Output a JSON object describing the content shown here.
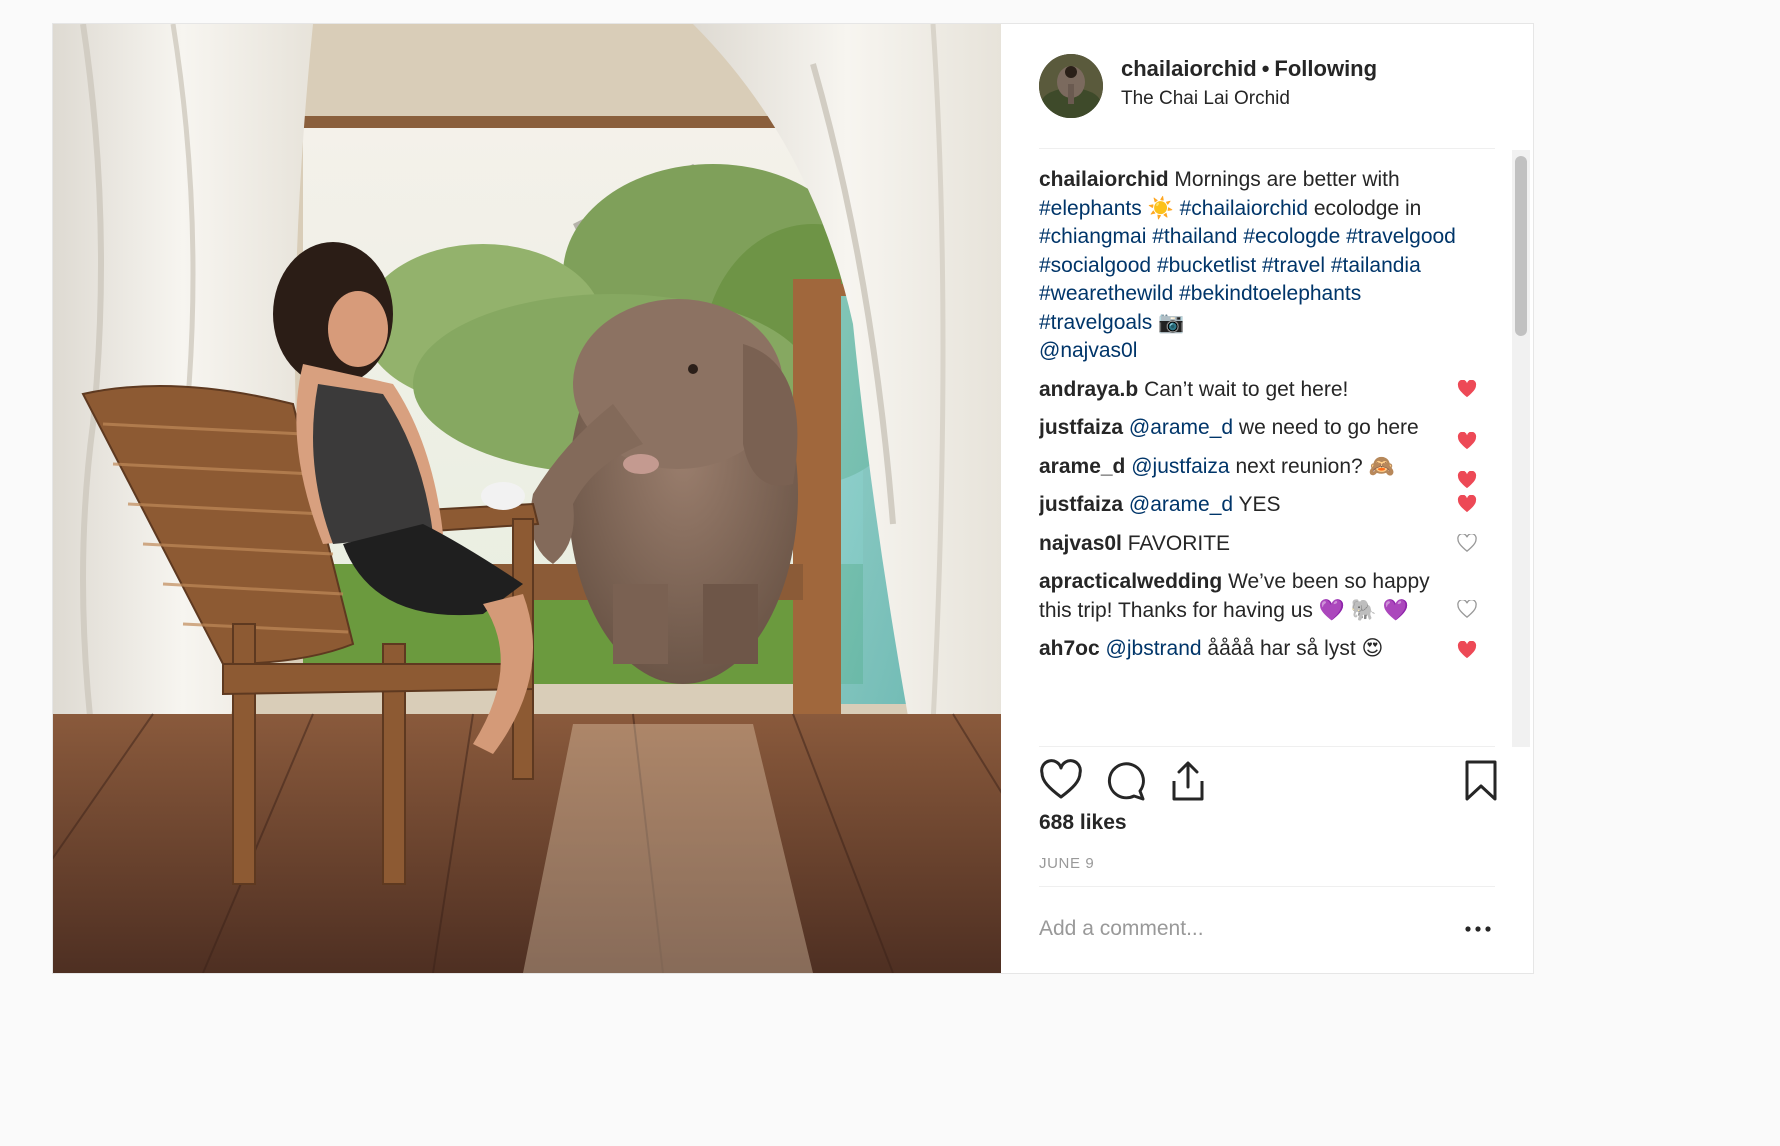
{
  "header": {
    "username": "chailaiorchid",
    "separator": "•",
    "follow_status": "Following",
    "location": "The Chai Lai Orchid"
  },
  "caption": {
    "user": "chailaiorchid",
    "text_lead": "Mornings are better with",
    "tag_elephants": "#elephants",
    "emoji_sun": "☀️",
    "tag_chailaiorchid": "#chailaiorchid",
    "text_ecolodge": "ecolodge in",
    "tags_line": [
      "#chiangmai",
      "#thailand",
      "#ecologde",
      "#travelgood",
      "#socialgood",
      "#bucketlist",
      "#travel",
      "#tailandia",
      "#wearethewild",
      "#bekindtoelephants",
      "#travelgoals"
    ],
    "emoji_camera": "📷",
    "mention": "@najvas0l"
  },
  "comments": [
    {
      "user": "andraya.b",
      "mention": "",
      "text": "Can’t wait to get here!",
      "liked": true
    },
    {
      "user": "justfaiza",
      "mention": "@arame_d",
      "text": "we need to go here",
      "liked": true
    },
    {
      "user": "arame_d",
      "mention": "@justfaiza",
      "text": "next reunion? 🙈",
      "liked": true
    },
    {
      "user": "justfaiza",
      "mention": "@arame_d",
      "text": "YES",
      "liked": true
    },
    {
      "user": "najvas0l",
      "mention": "",
      "text": "FAVORITE",
      "liked": false
    },
    {
      "user": "apracticalwedding",
      "mention": "",
      "text": "We’ve been so happy this trip! Thanks for having us 💜 🐘 💜",
      "liked": false
    },
    {
      "user": "ah7oc",
      "mention": "@jbstrand",
      "text": "åååå har så lyst 😍",
      "liked": true
    }
  ],
  "likes": "688 likes",
  "date": "JUNE 9",
  "comment_box": {
    "placeholder": "Add a comment...",
    "more": "•••"
  },
  "icons": {
    "like": "heart-icon",
    "comment": "comment-bubble-icon",
    "share": "share-icon",
    "save": "bookmark-icon",
    "comment_like_on": "heart-filled-icon",
    "comment_like_off": "heart-outline-icon"
  },
  "colors": {
    "liked_heart": "#ed4956",
    "hashtag": "#003569",
    "muted": "#999999"
  }
}
